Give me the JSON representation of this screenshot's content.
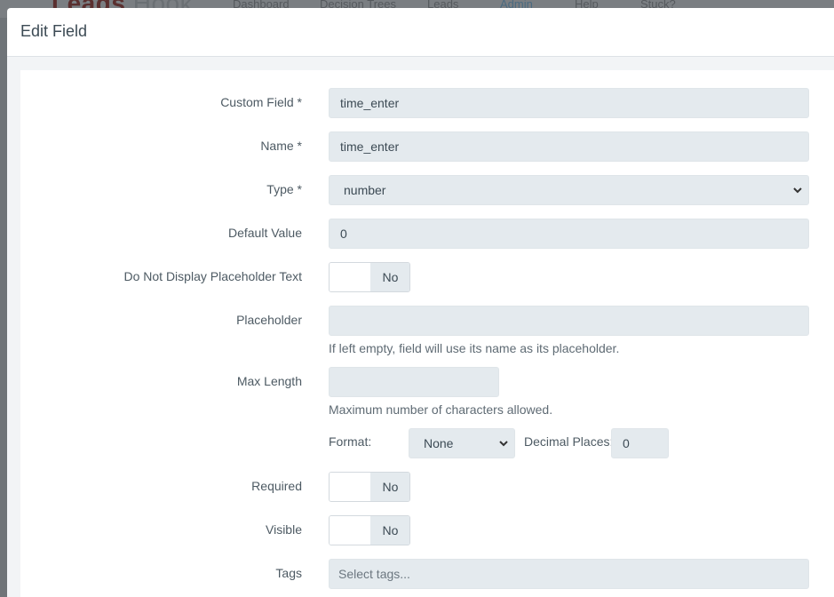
{
  "background": {
    "logo_bold": "Leads",
    "logo_light": "Hook",
    "nav": [
      "Dashboard",
      "Decision Trees",
      "Leads",
      "Admin",
      "Help",
      "Stuck?"
    ]
  },
  "modal": {
    "title": "Edit Field"
  },
  "form": {
    "custom_field": {
      "label": "Custom Field *",
      "value": "time_enter"
    },
    "name": {
      "label": "Name *",
      "value": "time_enter"
    },
    "type": {
      "label": "Type *",
      "value": "number"
    },
    "default_value": {
      "label": "Default Value",
      "value": "0"
    },
    "no_placeholder": {
      "label": "Do Not Display Placeholder Text",
      "state": "No"
    },
    "placeholder": {
      "label": "Placeholder",
      "value": "",
      "help": "If left empty, field will use its name as its placeholder."
    },
    "max_length": {
      "label": "Max Length",
      "value": "",
      "help": "Maximum number of characters allowed."
    },
    "format": {
      "label": "Format:",
      "value": "None"
    },
    "decimal_places": {
      "label": "Decimal Places:",
      "value": "0"
    },
    "required": {
      "label": "Required",
      "state": "No"
    },
    "visible": {
      "label": "Visible",
      "state": "No"
    },
    "tags": {
      "label": "Tags",
      "placeholder": "Select tags..."
    }
  },
  "colors": {
    "input_bg": "#e4eaee",
    "title": "#3c4a54",
    "label": "#4d5a63"
  }
}
